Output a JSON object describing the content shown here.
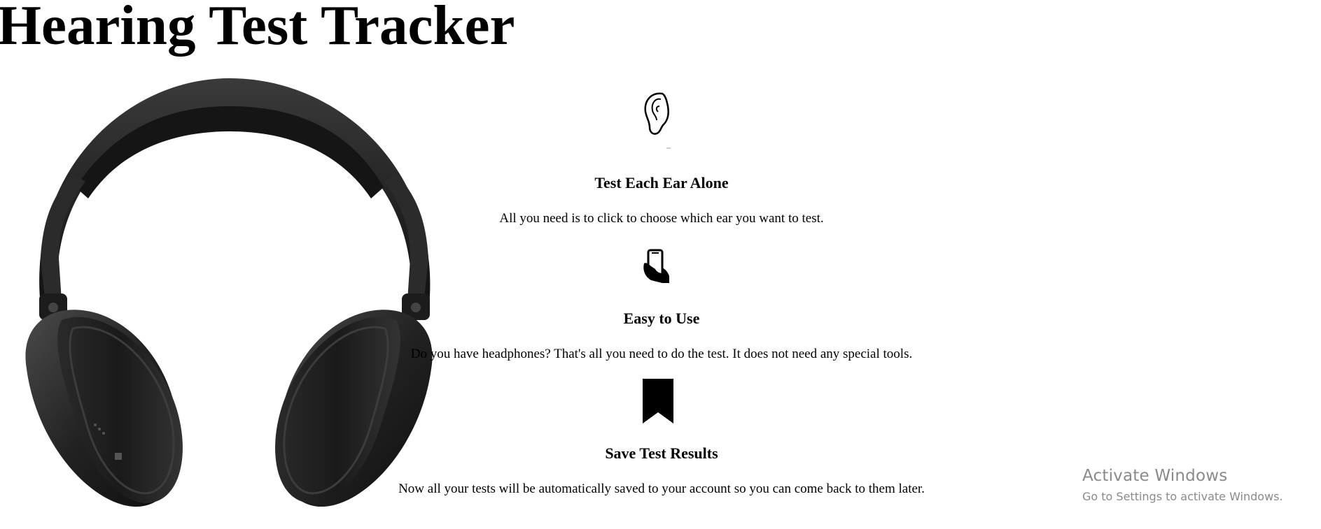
{
  "title": "Hearing Test Tracker",
  "hero": {
    "image": "headphones-image"
  },
  "features": [
    {
      "icon": "ear-icon",
      "heading": "Test Each Ear Alone",
      "text": "All you need is to click to choose which ear you want to test."
    },
    {
      "icon": "phone-in-hand-icon",
      "heading": "Easy to Use",
      "text": "Do you have headphones? That's all you need to do the test. It does not need any special tools."
    },
    {
      "icon": "bookmark-icon",
      "heading": "Save Test Results",
      "text": "Now all your tests will be automatically saved to your account so you can come back to them later."
    }
  ],
  "watermark": {
    "line1": "Activate Windows",
    "line2": "Go to Settings to activate Windows."
  },
  "colors": {
    "text": "#000000",
    "watermark": "#8a8a8a",
    "headphones": "#1e1e1e"
  }
}
